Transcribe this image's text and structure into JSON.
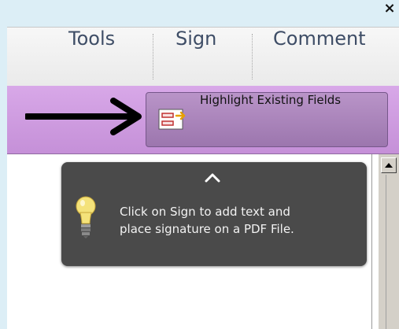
{
  "window": {
    "close_glyph": "×"
  },
  "toolbar": {
    "tools_label": "Tools",
    "sign_label": "Sign",
    "comment_label": "Comment"
  },
  "forms_bar": {
    "highlight_label": "Highlight Existing Fields",
    "highlight_icon": "form-fields-icon",
    "arrow_icon": "arrow-right-icon",
    "bar_color": "#cfa0e2",
    "button_color": "#a982bb"
  },
  "tooltip": {
    "icon": "lightbulb-icon",
    "text_line1": "Click on Sign to add text and",
    "text_line2": "place signature on a PDF File.",
    "background": "#4a4a4a"
  },
  "colors": {
    "page_background": "#dceef6",
    "toolbar_text": "#3e4d66"
  }
}
